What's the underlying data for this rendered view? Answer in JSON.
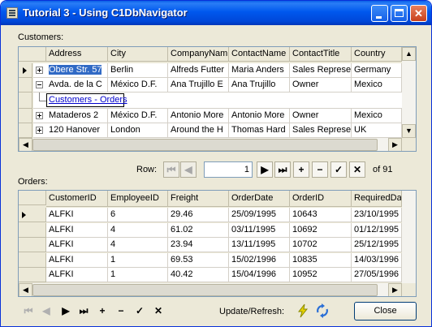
{
  "window": {
    "title": "Tutorial 3 - Using C1DbNavigator",
    "min_glyph": "_",
    "max_glyph": "□",
    "close_glyph": "✕"
  },
  "customers_label": "Customers:",
  "orders_label": "Orders:",
  "customers_grid": {
    "headers": [
      "Address",
      "City",
      "CompanyNam",
      "ContactName",
      "ContactTitle",
      "Country"
    ],
    "rows": [
      [
        "Obere Str. 57",
        "Berlin",
        "Alfreds Futter",
        "Maria Anders",
        "Sales Represe",
        "Germany"
      ],
      [
        "Avda. de la C",
        "México D.F.",
        "Ana Trujillo E",
        "Ana Trujillo",
        "Owner",
        "Mexico"
      ],
      [
        "Mataderos  2",
        "México D.F.",
        "Antonio More",
        "Antonio More",
        "Owner",
        "Mexico"
      ],
      [
        "120 Hanover",
        "London",
        "Around the H",
        "Thomas Hard",
        "Sales Represe",
        "UK"
      ]
    ],
    "child_relation_link": "Customers - Orders"
  },
  "navigator": {
    "row_label": "Row:",
    "row_value": "1",
    "of_text": "of 91",
    "buttons": {
      "first": "⏮",
      "prev": "◀",
      "next": "▶",
      "last": "⏭",
      "add": "+",
      "delete": "−",
      "apply": "✓",
      "cancel": "✕"
    }
  },
  "orders_grid": {
    "headers": [
      "CustomerID",
      "EmployeeID",
      "Freight",
      "OrderDate",
      "OrderID",
      "RequiredDa"
    ],
    "rows": [
      [
        "ALFKI",
        "6",
        "29.46",
        "25/09/1995",
        "10643",
        "23/10/1995"
      ],
      [
        "ALFKI",
        "4",
        "61.02",
        "03/11/1995",
        "10692",
        "01/12/1995"
      ],
      [
        "ALFKI",
        "4",
        "23.94",
        "13/11/1995",
        "10702",
        "25/12/1995"
      ],
      [
        "ALFKI",
        "1",
        "69.53",
        "15/02/1996",
        "10835",
        "14/03/1996"
      ],
      [
        "ALFKI",
        "1",
        "40.42",
        "15/04/1996",
        "10952",
        "27/05/1996"
      ]
    ]
  },
  "bottom_nav": {
    "buttons": {
      "first": "⏮",
      "prev": "◀",
      "next": "▶",
      "last": "⏭",
      "add": "+",
      "delete": "−",
      "apply": "✓",
      "cancel": "✕"
    },
    "update_label": "Update/Refresh:",
    "close_label": "Close"
  }
}
